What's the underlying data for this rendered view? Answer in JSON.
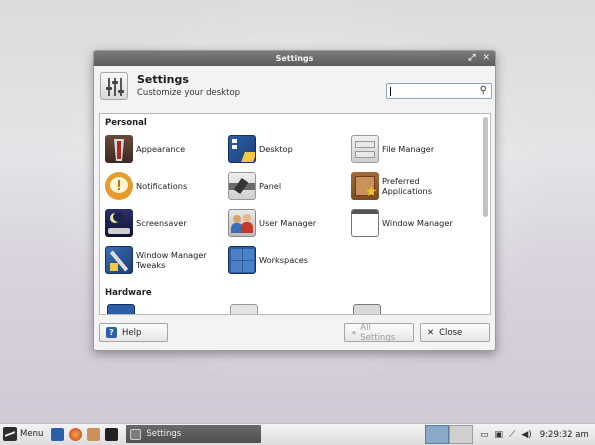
{
  "window": {
    "title": "Settings",
    "controls": [
      "⤢",
      "✕"
    ]
  },
  "header": {
    "title": "Settings",
    "subtitle": "Customize your desktop",
    "search_placeholder": "",
    "search_value": ""
  },
  "sections": [
    {
      "title": "Personal",
      "items": [
        {
          "label": "Appearance",
          "icon": "appearance-icon"
        },
        {
          "label": "Desktop",
          "icon": "desktop-icon"
        },
        {
          "label": "File Manager",
          "icon": "file-manager-icon"
        },
        {
          "label": "Notifications",
          "icon": "notifications-icon"
        },
        {
          "label": "Panel",
          "icon": "panel-icon"
        },
        {
          "label": "Preferred\nApplications",
          "icon": "preferred-applications-icon"
        },
        {
          "label": "Screensaver",
          "icon": "screensaver-icon"
        },
        {
          "label": "User Manager",
          "icon": "user-manager-icon"
        },
        {
          "label": "Window Manager",
          "icon": "window-manager-icon"
        },
        {
          "label": "Window Manager\nTweaks",
          "icon": "window-manager-tweaks-icon"
        },
        {
          "label": "Workspaces",
          "icon": "workspaces-icon"
        }
      ]
    },
    {
      "title": "Hardware",
      "items": []
    }
  ],
  "footer": {
    "help_label": "Help",
    "all_settings_label": "All Settings",
    "close_label": "Close"
  },
  "taskbar": {
    "menu_label": "Menu",
    "task_label": "Settings",
    "clock": "9:29:32 am"
  },
  "colors": {
    "titlebar": "#6a6a6a",
    "accent": "#2d5fa8",
    "taskbar_active": "#5a5a5a"
  }
}
